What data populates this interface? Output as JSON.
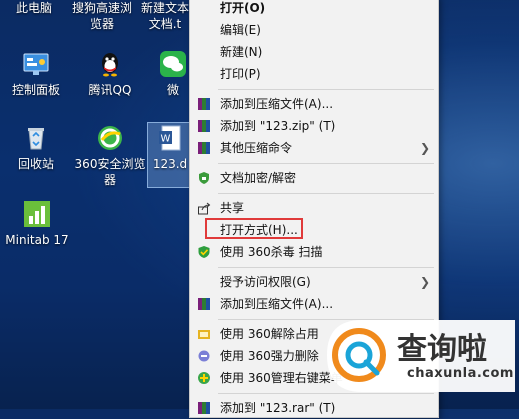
{
  "desktop": {
    "icons": [
      {
        "label": "此电脑"
      },
      {
        "label": "搜狗高速浏览器"
      },
      {
        "label": "新建文本文档.t"
      },
      {
        "label": "控制面板"
      },
      {
        "label": "腾讯QQ"
      },
      {
        "label": "微"
      },
      {
        "label": "回收站"
      },
      {
        "label": "360安全浏览器"
      },
      {
        "label": "123.d"
      },
      {
        "label": "Minitab 17"
      }
    ]
  },
  "menu": {
    "items": [
      {
        "label": "打开(O)"
      },
      {
        "label": "编辑(E)"
      },
      {
        "label": "新建(N)"
      },
      {
        "label": "打印(P)"
      },
      {
        "label": "添加到压缩文件(A)..."
      },
      {
        "label": "添加到 \"123.zip\" (T)"
      },
      {
        "label": "其他压缩命令"
      },
      {
        "label": "文档加密/解密"
      },
      {
        "label": "共享"
      },
      {
        "label": "打开方式(H)..."
      },
      {
        "label": "使用 360杀毒 扫描"
      },
      {
        "label": "授予访问权限(G)"
      },
      {
        "label": "添加到压缩文件(A)..."
      },
      {
        "label": "使用 360解除占用"
      },
      {
        "label": "使用 360强力删除"
      },
      {
        "label": "使用 360管理右键菜单"
      },
      {
        "label": "添加到 \"123.rar\" (T)"
      }
    ]
  },
  "watermark": {
    "title": "查询啦",
    "subtitle": "chaxunla.com"
  },
  "colors": {
    "highlight_border": "#e03a3a",
    "menu_bg": "#f2f2f2",
    "desktop_bg": "#0a2f6e"
  }
}
